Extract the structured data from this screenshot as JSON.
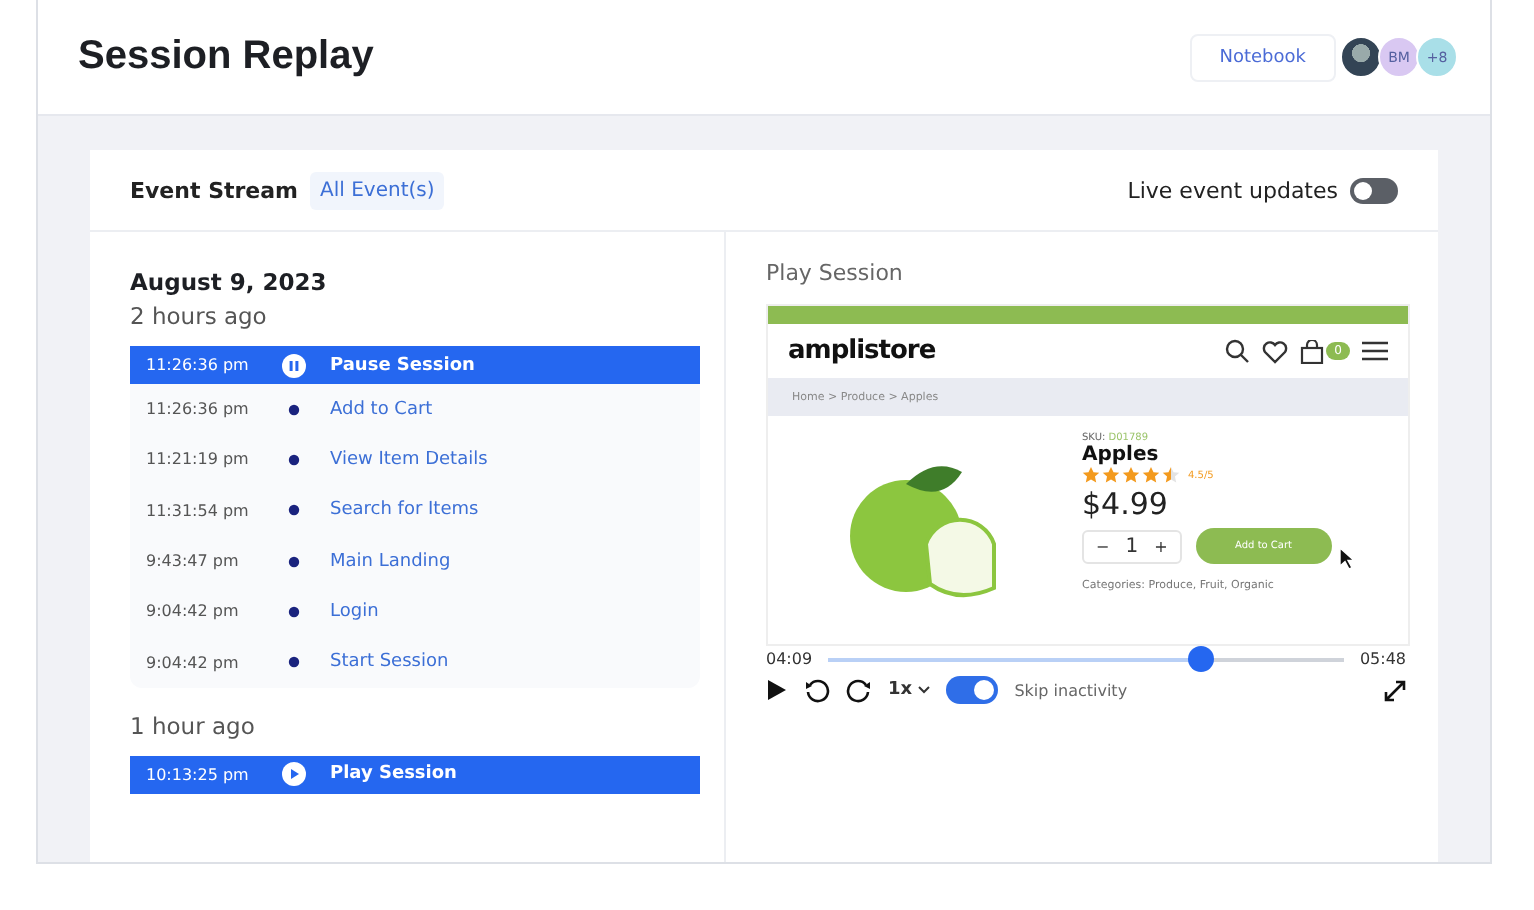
{
  "header": {
    "title": "Session Replay",
    "notebook_button": "Notebook",
    "avatars": [
      {
        "kind": "photo"
      },
      {
        "kind": "initials",
        "label": "BM",
        "color": "#d9c8f2"
      },
      {
        "kind": "count",
        "label": "+8",
        "color": "#a9dfe8"
      }
    ]
  },
  "event_stream": {
    "title": "Event Stream",
    "filter": "All Event(s)",
    "live_updates": {
      "label": "Live event updates",
      "on": false
    },
    "date": "August 9, 2023",
    "groups": [
      {
        "heading": "2 hours ago",
        "events": [
          {
            "time": "11:26:36 pm",
            "label": "Pause Session",
            "kind": "pause",
            "selected": true
          },
          {
            "time": "11:26:36 pm",
            "label": "Add to Cart",
            "kind": "event",
            "selected": false
          },
          {
            "time": "11:21:19 pm",
            "label": "View Item Details",
            "kind": "event",
            "selected": false
          },
          {
            "time": "11:31:54 pm",
            "label": "Search for Items",
            "kind": "event",
            "selected": false
          },
          {
            "time": "9:43:47 pm",
            "label": "Main Landing",
            "kind": "event",
            "selected": false
          },
          {
            "time": "9:04:42 pm",
            "label": "Login",
            "kind": "event",
            "selected": false
          },
          {
            "time": "9:04:42 pm",
            "label": "Start Session",
            "kind": "event",
            "selected": false
          }
        ]
      },
      {
        "heading": "1 hour ago",
        "events": [
          {
            "time": "10:13:25 pm",
            "label": "Play Session",
            "kind": "play",
            "selected": true
          }
        ]
      }
    ]
  },
  "player": {
    "title": "Play Session",
    "store": {
      "logo": "amplistore",
      "cart_count": "0",
      "breadcrumb": "Home > Produce > Apples",
      "sku_label": "SKU:",
      "sku": "D01789",
      "product": "Apples",
      "stars": 4.5,
      "rating": "4.5/5",
      "price": "$4.99",
      "minus": "−",
      "quantity": "1",
      "plus": "+",
      "add_button": "Add to Cart",
      "categories": "Categories: Produce, Fruit, Organic"
    },
    "current_time": "04:09",
    "total_time": "05:48",
    "progress": {
      "level": 0.72
    },
    "speed": "1x",
    "skip_inactivity": {
      "label": "Skip inactivity",
      "on": true
    }
  }
}
